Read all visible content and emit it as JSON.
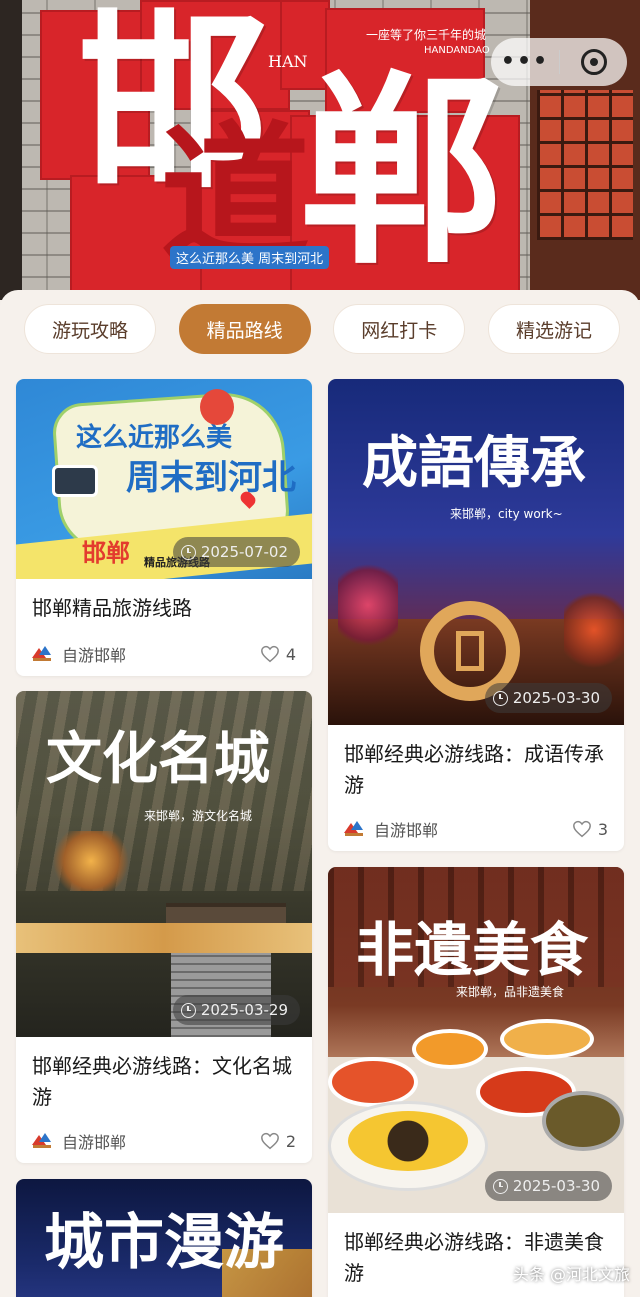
{
  "hero": {
    "big_char_1": "邯",
    "big_char_2": "郸",
    "ghost_char": "道",
    "han": "HAN",
    "slogan": "一座等了你三千年的城",
    "slogan_sub": "HANDANDAO",
    "mini_logo": "这么近那么美 周末到河北",
    "capsule_more": "•••"
  },
  "tabs": [
    {
      "label": "游玩攻略",
      "active": false
    },
    {
      "label": "精品路线",
      "active": true
    },
    {
      "label": "网红打卡",
      "active": false
    },
    {
      "label": "精选游记",
      "active": false
    }
  ],
  "cards": [
    {
      "date": "2025-07-02",
      "title": "邯郸精品旅游线路",
      "author": "自游邯郸",
      "likes": "4",
      "art_line1": "这么近那么美",
      "art_line2": "周末到河北",
      "art_badge": "邯郸",
      "art_badge_sub": "精品旅游线路"
    },
    {
      "date": "2025-03-30",
      "title": "邯郸经典必游线路：成语传承游",
      "author": "自游邯郸",
      "likes": "3",
      "art_line1": "成語傳承",
      "art_sub": "来邯郸，city work~"
    },
    {
      "date": "2025-03-29",
      "title": "邯郸经典必游线路：文化名城游",
      "author": "自游邯郸",
      "likes": "2",
      "art_line1": "文化名城",
      "art_sub": "来邯郸，游文化名城"
    },
    {
      "date": "2025-03-30",
      "title": "邯郸经典必游线路：非遗美食游",
      "art_line1": "非遺美食",
      "art_sub": "来邯郸，品非遗美食"
    },
    {
      "art_line1": "城市漫游"
    }
  ],
  "watermark": "头条 @河北文旅",
  "colors": {
    "accent": "#c27a34",
    "brand_red": "#d8252a"
  }
}
